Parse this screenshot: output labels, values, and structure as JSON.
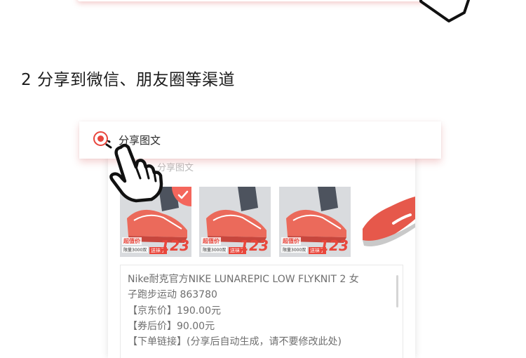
{
  "step": {
    "title": "2 分享到微信、朋友圈等渠道"
  },
  "share_option": {
    "label": "分享图文",
    "selected": true,
    "accent": "#e8453c"
  },
  "panel": {
    "ghost_label": "分享图文",
    "thumbnails": [
      {
        "name": "shoe-promo-1",
        "promo_title": "超值价",
        "promo_sub": "限量3000双",
        "promo_tag": "送袜子",
        "price": "123",
        "checked": true
      },
      {
        "name": "shoe-promo-2",
        "promo_title": "超值价",
        "promo_sub": "限量3000双",
        "promo_tag": "送袜子",
        "price": "123",
        "checked": false
      },
      {
        "name": "shoe-promo-3",
        "promo_title": "超值价",
        "promo_sub": "限量3000双",
        "promo_tag": "送袜子",
        "price": "123",
        "checked": false
      },
      {
        "name": "shoe-plain",
        "checked": false
      }
    ],
    "text_lines": [
      "Nike耐克官方NIKE LUNAREPIC LOW FLYKNIT 2 女",
      "子跑步运动 863780",
      "【京东价】190.00元",
      "【券后价】90.00元",
      "【下单链接】(分享后自动生成，请不要修改此处)"
    ]
  },
  "icons": {
    "hand": "pointing-hand-icon",
    "check": "check-icon",
    "radio": "radio-selected-icon"
  }
}
